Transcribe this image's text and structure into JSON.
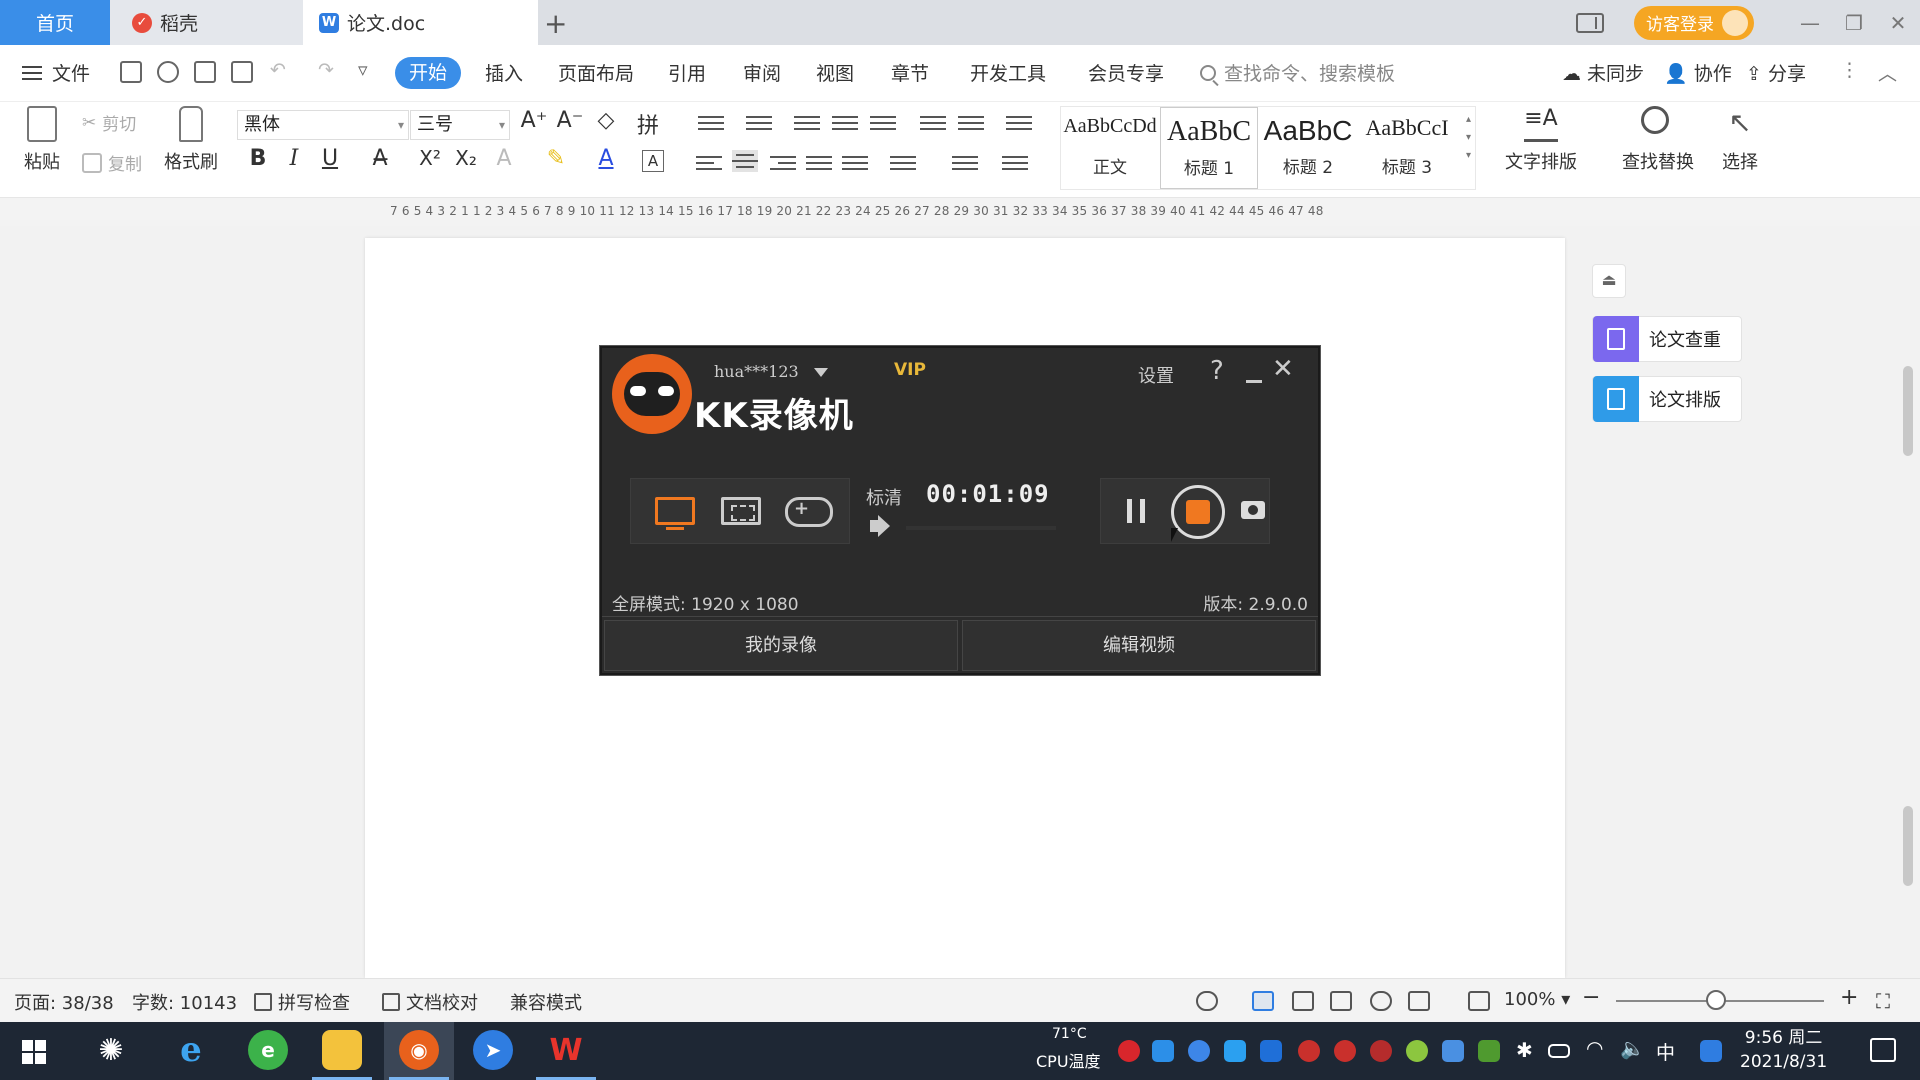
{
  "tabs": {
    "home": "首页",
    "daoke": "稻壳",
    "doc": "论文.doc",
    "plus": "+"
  },
  "window": {
    "visitor_login": "访客登录",
    "minimize": "—",
    "restore": "❐",
    "close": "✕"
  },
  "menu": {
    "file": "文件",
    "items": [
      "开始",
      "插入",
      "页面布局",
      "引用",
      "审阅",
      "视图",
      "章节",
      "开发工具",
      "会员专享"
    ],
    "search_placeholder": "查找命令、搜索模板",
    "unsynced": "未同步",
    "collab": "协作",
    "share": "分享"
  },
  "ribbon": {
    "paste": "粘贴",
    "cut": "剪切",
    "copy": "复制",
    "format_painter": "格式刷",
    "font_name": "黑体",
    "font_size": "三号",
    "bold": "B",
    "italic": "I",
    "underline": "U",
    "styles": [
      {
        "sample": "AaBbCcDd",
        "name": "正文"
      },
      {
        "sample": "AaBbC",
        "name": "标题 1"
      },
      {
        "sample": "AaBbC",
        "name": "标题 2"
      },
      {
        "sample": "AaBbCcI",
        "name": "标题 3"
      }
    ],
    "text_layout": "文字排版",
    "find_replace": "查找替换",
    "select": "选择"
  },
  "ruler": "7 6 5 4 3 2 1    1 2 3 4 5 6 7 8 9 10 11 12 13 14 15 16 17 18 19 20 21 22 23 24 25 26 27 28 29 30 31 32 33 34 35 36 37 38 39 40 41 42    44 45 46 47 48",
  "side_panel": {
    "check": "论文查重",
    "layout": "论文排版"
  },
  "recorder": {
    "user": "hua***123",
    "vip": "VIP",
    "title": "KK录像机",
    "settings": "设置",
    "help": "?",
    "close": "✕",
    "quality": "标清",
    "timer": "00:01:09",
    "mode_text": "全屏模式: 1920 x 1080",
    "version": "版本: 2.9.0.0",
    "my_recordings": "我的录像",
    "edit_video": "编辑视频",
    "accent_color": "#f07820"
  },
  "status": {
    "page": "页面: 38/38",
    "words": "字数: 10143",
    "spell_check": "拼写检查",
    "doc_proof": "文档校对",
    "compat_mode": "兼容模式",
    "zoom": "100%",
    "zoom_minus": "−",
    "zoom_plus": "+"
  },
  "taskbar": {
    "cpu_temp": "71°C",
    "cpu_label": "CPU温度",
    "ime": "中",
    "time": "9:56 周二",
    "date": "2021/8/31"
  }
}
